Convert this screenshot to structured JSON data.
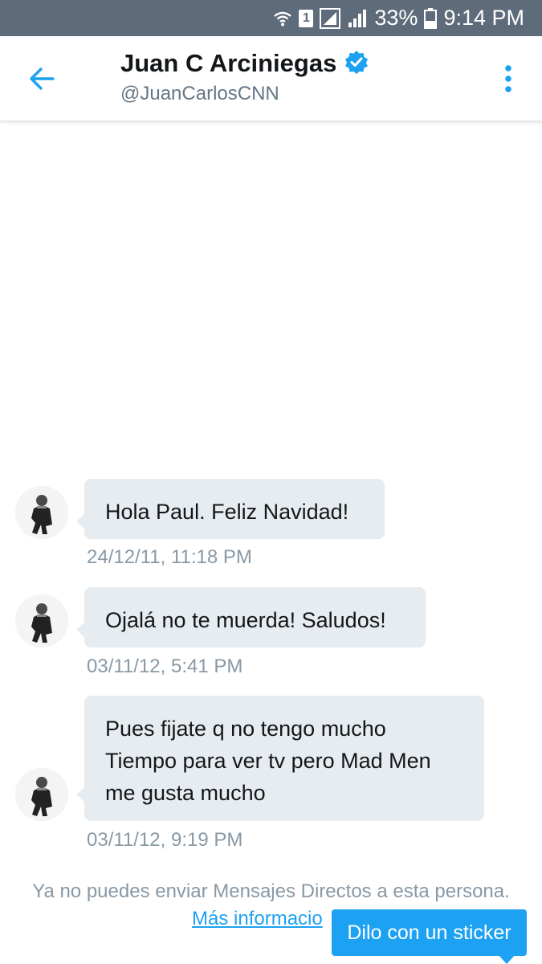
{
  "status_bar": {
    "battery": "33%",
    "time": "9:14 PM",
    "sim_label": "1",
    "icons": [
      "wifi-icon",
      "sim-icon",
      "signal-icon",
      "signal-icon",
      "battery-icon"
    ]
  },
  "header": {
    "name": "Juan C Arciniegas",
    "handle": "@JuanCarlosCNN",
    "verified": true,
    "accent_color": "#1da1f2"
  },
  "messages": [
    {
      "text": "Hola Paul. Feliz Navidad!",
      "timestamp": "24/12/11, 11:18 PM"
    },
    {
      "text": "Ojalá no te muerda! Saludos!",
      "timestamp": "03/11/12, 5:41 PM"
    },
    {
      "lines": [
        "Pues fijate q no tengo mucho",
        "Tiempo para ver tv pero Mad Men",
        "me gusta mucho"
      ],
      "timestamp": "03/11/12, 9:19 PM"
    }
  ],
  "footer": {
    "notice": "Ya no puedes enviar Mensajes Directos a esta persona.",
    "more_info": "Más informacio",
    "sticker_prompt": "Dilo con un sticker"
  }
}
